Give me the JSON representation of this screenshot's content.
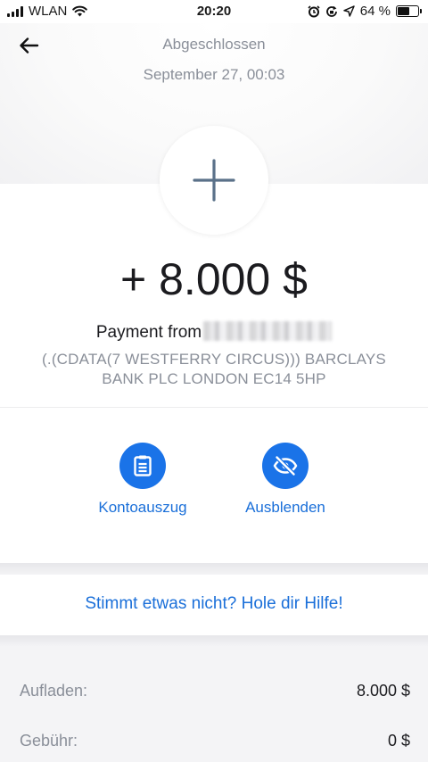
{
  "status_bar": {
    "carrier": "WLAN",
    "time": "20:20",
    "battery": "64 %",
    "battery_level": 0.64
  },
  "header": {
    "status": "Abgeschlossen",
    "date": "September 27, 00:03"
  },
  "transaction": {
    "amount": "+ 8.000 $",
    "payer_prefix": "Payment from",
    "address": "(.(CDATA(7 WESTFERRY CIRCUS))) BARCLAYS BANK PLC LONDON EC14 5HP"
  },
  "actions": [
    {
      "label": "Kontoauszug",
      "icon": "statement-icon"
    },
    {
      "label": "Ausblenden",
      "icon": "eye-off-icon"
    }
  ],
  "help": {
    "label": "Stimmt etwas nicht? Hole dir Hilfe!"
  },
  "details": [
    {
      "key": "Aufladen:",
      "value": "8.000 $"
    },
    {
      "key": "Gebühr:",
      "value": "0 $"
    }
  ],
  "colors": {
    "accent": "#1a73e8",
    "muted": "#8a8f99"
  }
}
